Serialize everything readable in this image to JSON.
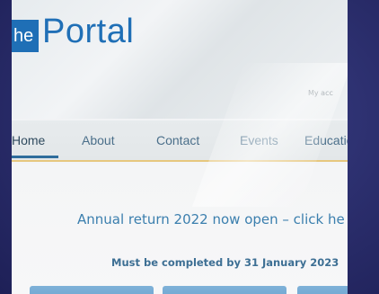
{
  "brand": {
    "logo_box_text": "he",
    "logo_text": "Portal",
    "brand_color": "#1f6fb6"
  },
  "header": {
    "account_link": "My acc"
  },
  "nav": {
    "items": [
      {
        "label": "Home",
        "active": true
      },
      {
        "label": "About",
        "active": false
      },
      {
        "label": "Contact",
        "active": false
      },
      {
        "label": "Events",
        "active": false
      },
      {
        "label": "Educatio",
        "active": false
      }
    ]
  },
  "content": {
    "banner": "Annual return 2022 now open – click he",
    "deadline": "Must be completed by 31 January 2023"
  },
  "colors": {
    "accent_underline": "#e6c77e",
    "link_blue": "#3b7fae",
    "tile_blue": "#6aa3cf"
  }
}
